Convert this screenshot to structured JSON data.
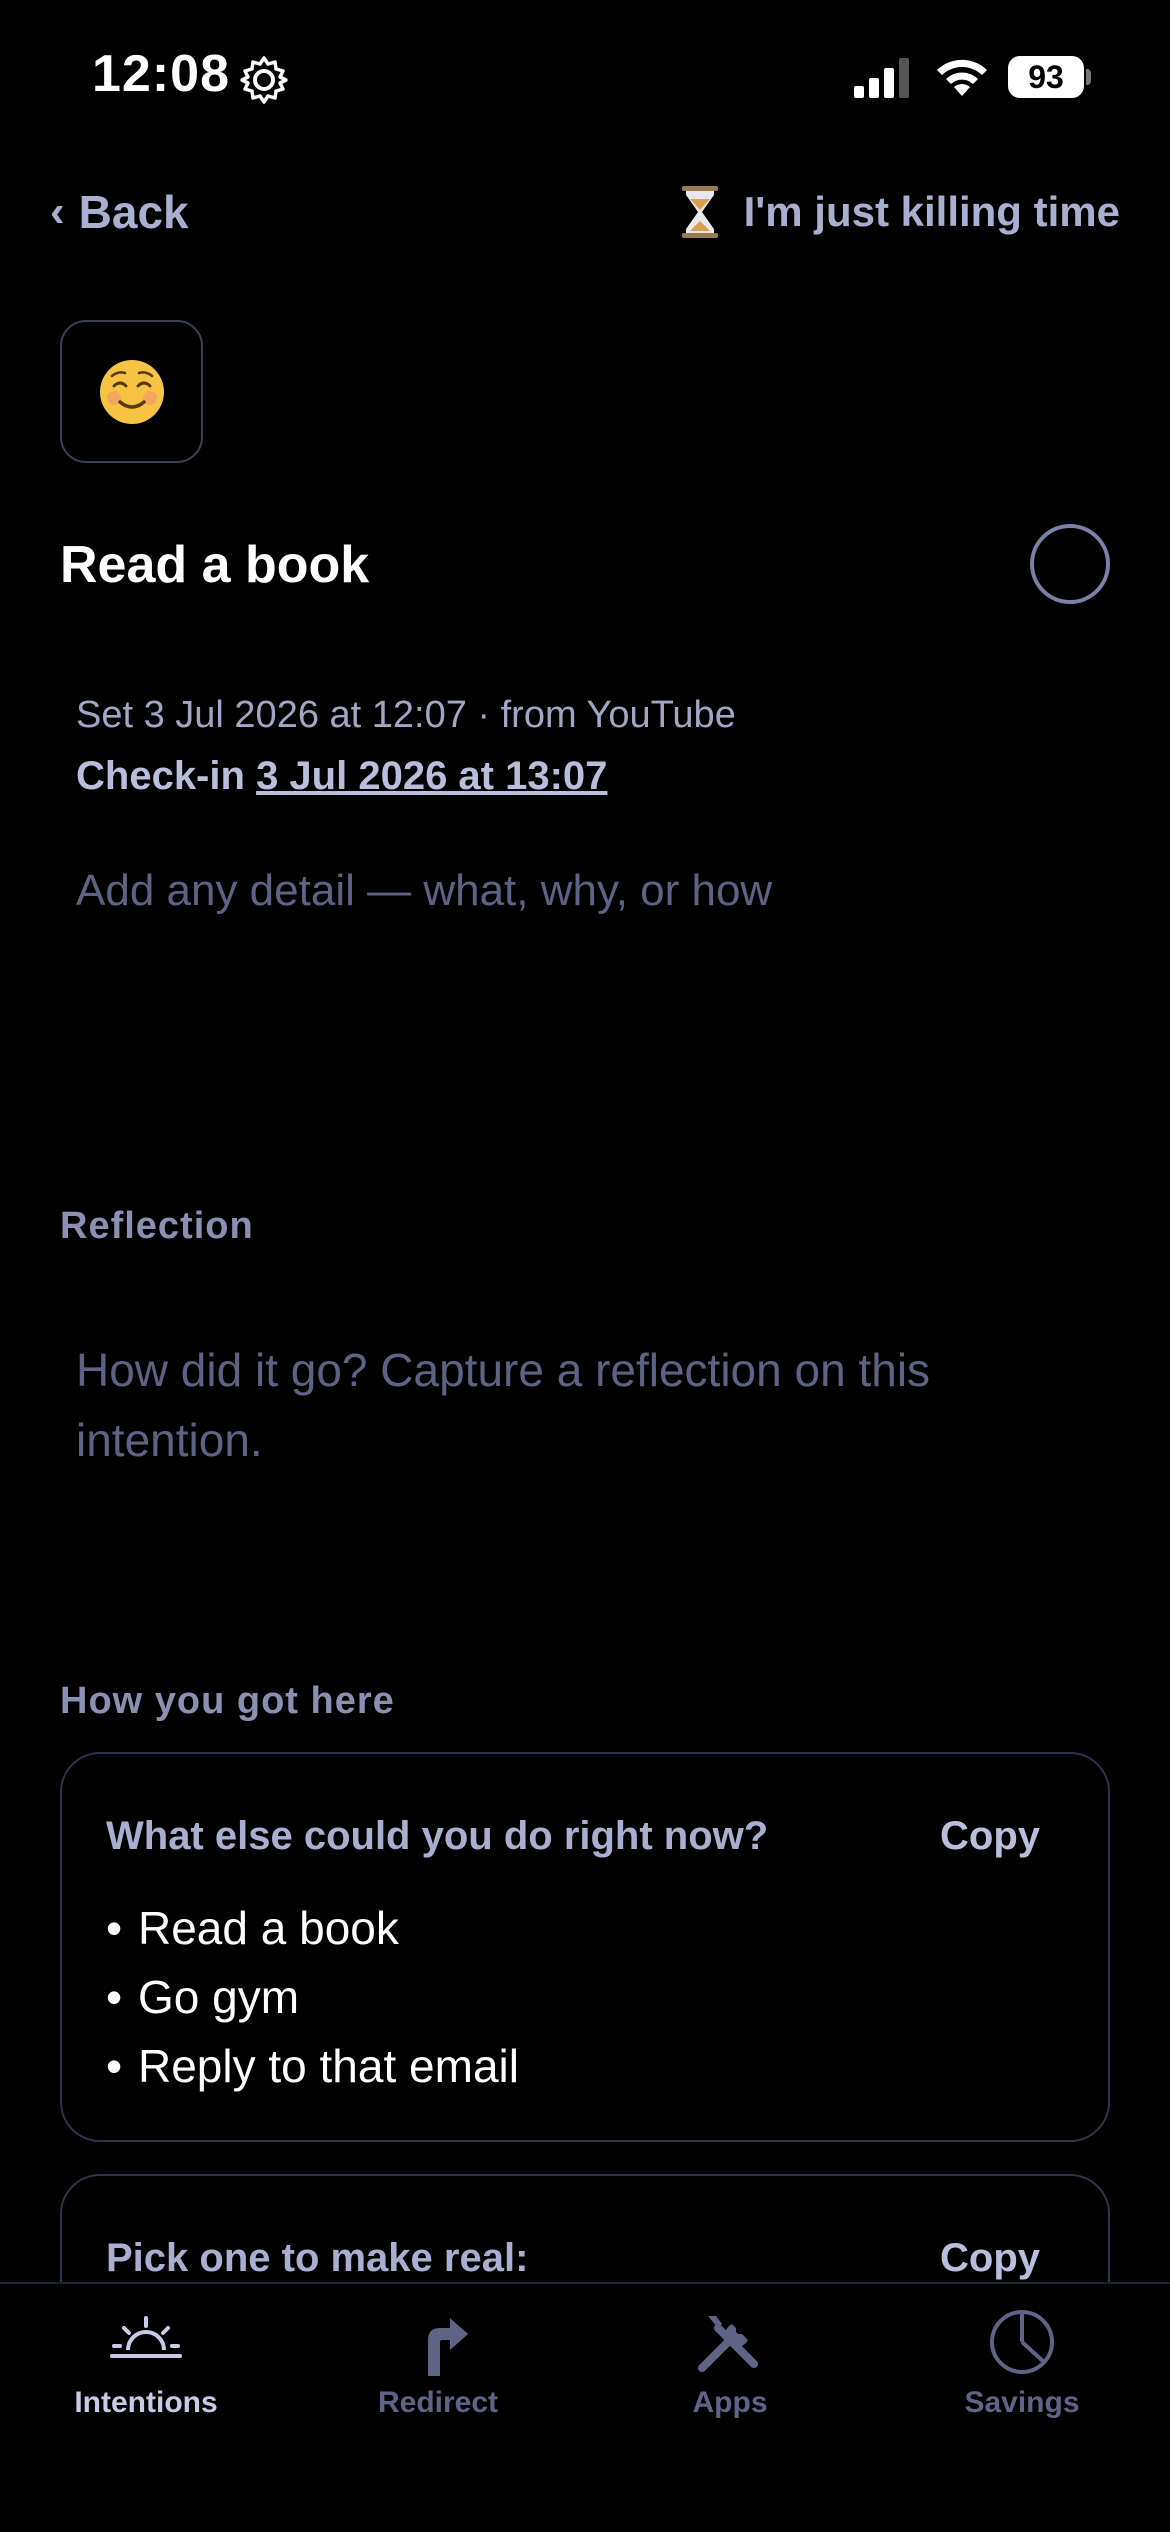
{
  "status_bar": {
    "time": "12:08",
    "battery": "93",
    "icons": [
      "gear-icon",
      "signal-icon",
      "wifi-icon",
      "battery-icon"
    ]
  },
  "nav": {
    "back_label": "Back",
    "mode_label": "I'm just killing time",
    "mode_icon": "hourglass-icon"
  },
  "intention": {
    "emoji": "smiling-face-icon",
    "title": "Read a book",
    "set_text": "Set 3 Jul 2026 at 12:07 · from YouTube",
    "checkin_prefix": "Check-in",
    "checkin_date": "3 Jul 2026 at 13:07",
    "detail_placeholder": "Add any detail — what, why, or how"
  },
  "reflection": {
    "label": "Reflection",
    "placeholder": "How did it go? Capture a reflection on this intention."
  },
  "how": {
    "label": "How you got here",
    "cards": [
      {
        "title": "What else could you do right now?",
        "copy_label": "Copy",
        "items": [
          "Read a book",
          "Go gym",
          "Reply to that email"
        ]
      },
      {
        "title": "Pick one to make real:",
        "copy_label": "Copy"
      }
    ]
  },
  "tab_bar": {
    "active": "Intentions",
    "tabs": [
      {
        "label": "Intentions",
        "icon": "sunrise-icon"
      },
      {
        "label": "Redirect",
        "icon": "redirect-arrow-icon"
      },
      {
        "label": "Apps",
        "icon": "tools-icon"
      },
      {
        "label": "Savings",
        "icon": "pie-chart-icon"
      }
    ]
  },
  "colors": {
    "background": "#000000",
    "accent_text": "#a8afd0",
    "placeholder": "#5c6384",
    "border": "#2e3350"
  }
}
